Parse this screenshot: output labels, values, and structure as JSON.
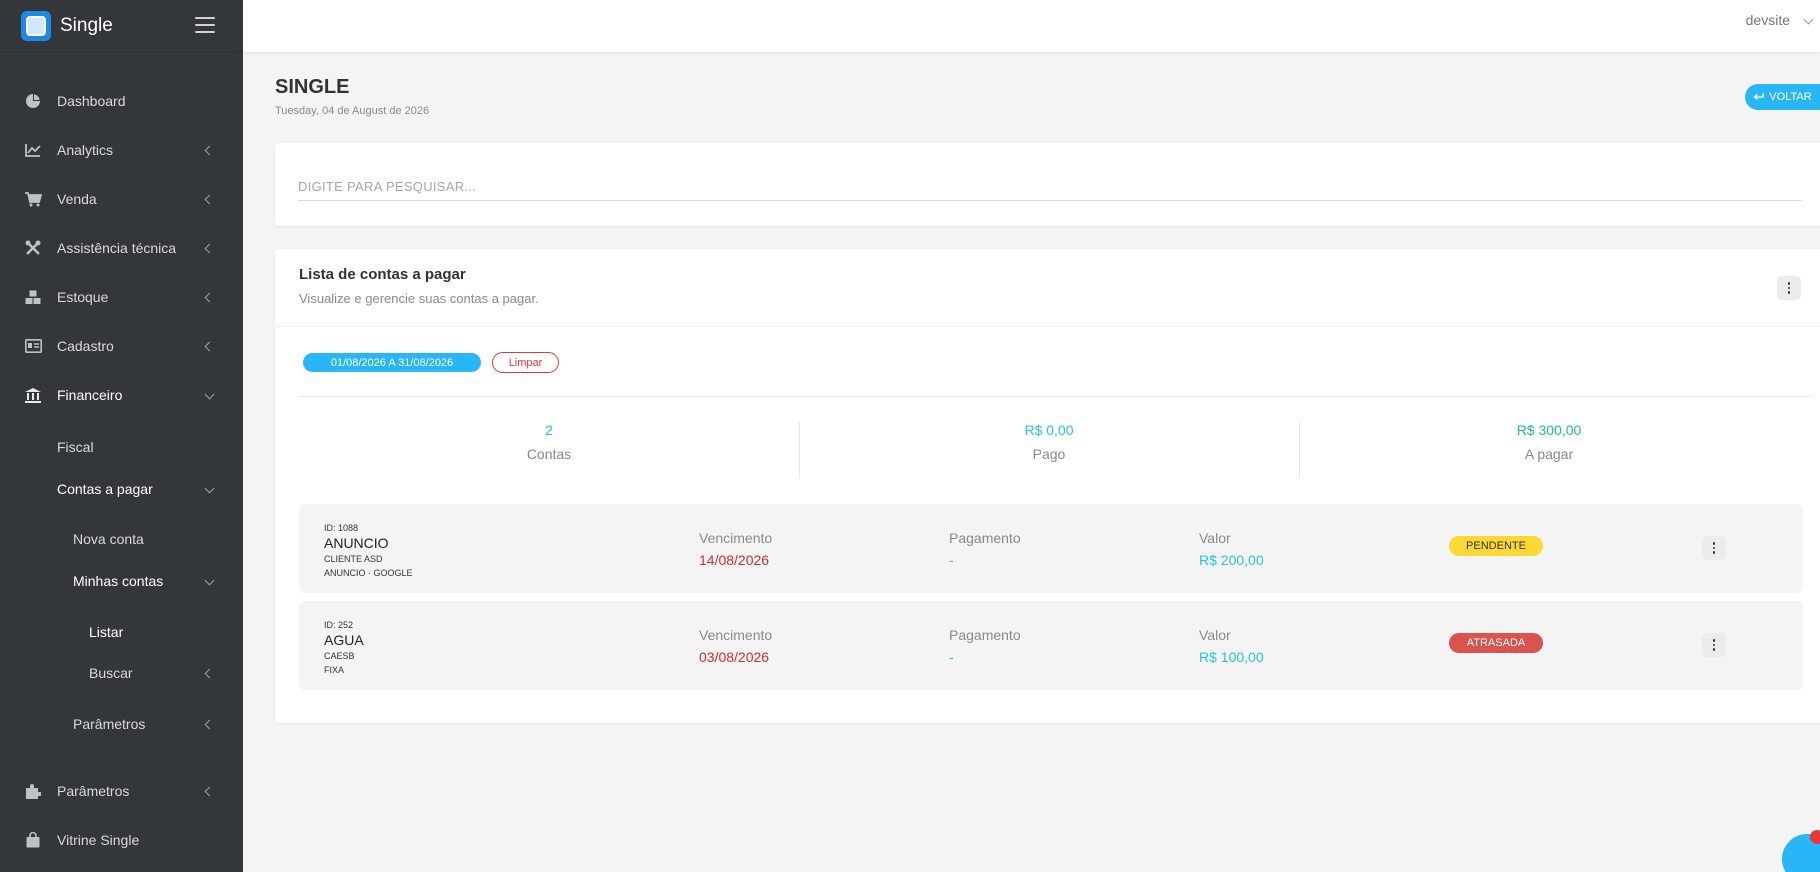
{
  "brand": {
    "name": "Single"
  },
  "user": {
    "name": "devsite"
  },
  "sidebar": {
    "items": [
      {
        "label": "Dashboard",
        "icon": "chart-pie-icon"
      },
      {
        "label": "Analytics",
        "icon": "line-chart-icon"
      },
      {
        "label": "Venda",
        "icon": "cart-icon"
      },
      {
        "label": "Assistência técnica",
        "icon": "tools-icon"
      },
      {
        "label": "Estoque",
        "icon": "boxes-icon"
      },
      {
        "label": "Cadastro",
        "icon": "id-card-icon"
      },
      {
        "label": "Financeiro",
        "icon": "bank-icon"
      },
      {
        "label": "Fiscal"
      },
      {
        "label": "Contas a pagar"
      },
      {
        "label": "Nova conta"
      },
      {
        "label": "Minhas contas"
      },
      {
        "label": "Listar"
      },
      {
        "label": "Buscar"
      },
      {
        "label": "Parâmetros"
      },
      {
        "label": "Parâmetros",
        "icon": "puzzle-icon"
      },
      {
        "label": "Vitrine Single",
        "icon": "bag-icon"
      }
    ]
  },
  "page": {
    "title": "SINGLE",
    "date": "Tuesday, 04 de August de 2026",
    "back_label": "VOLTAR"
  },
  "search": {
    "placeholder": "DIGITE PARA PESQUISAR..."
  },
  "list": {
    "title": "Lista de contas a pagar",
    "subtitle": "Visualize e gerencie suas contas a pagar.",
    "date_range": "01/08/2026 A 31/08/2026",
    "clear_label": "Limpar",
    "stats": [
      {
        "value": "2",
        "label": "Contas",
        "color": "#29b6f6"
      },
      {
        "value": "R$ 0,00",
        "label": "Pago",
        "color": "#26c6da"
      },
      {
        "value": "R$ 300,00",
        "label": "A pagar",
        "color": "#26b98a"
      }
    ],
    "accounts": [
      {
        "id": "ID: 1088",
        "name": "ANUNCIO",
        "line1": "CLIENTE ASD",
        "line2": "ANUNCIO · GOOGLE",
        "due_label": "Vencimento",
        "due": "14/08/2026",
        "pay_label": "Pagamento",
        "pay": "-",
        "value_label": "Valor",
        "value": "R$ 200,00",
        "status": "PENDENTE",
        "status_bg": "#fdd835",
        "status_color": "#333333"
      },
      {
        "id": "ID: 252",
        "name": "AGUA",
        "line1": "CAESB",
        "line2": "FIXA",
        "due_label": "Vencimento",
        "due": "03/08/2026",
        "pay_label": "Pagamento",
        "pay": "-",
        "value_label": "Valor",
        "value": "R$ 100,00",
        "status": "ATRASADA",
        "status_bg": "#d9534f",
        "status_color": "#ffffff"
      }
    ]
  },
  "colors": {
    "accent": "#29b6f6",
    "danger": "#e53935",
    "due_red": "#d32f2f",
    "value_teal": "#26c6da"
  }
}
